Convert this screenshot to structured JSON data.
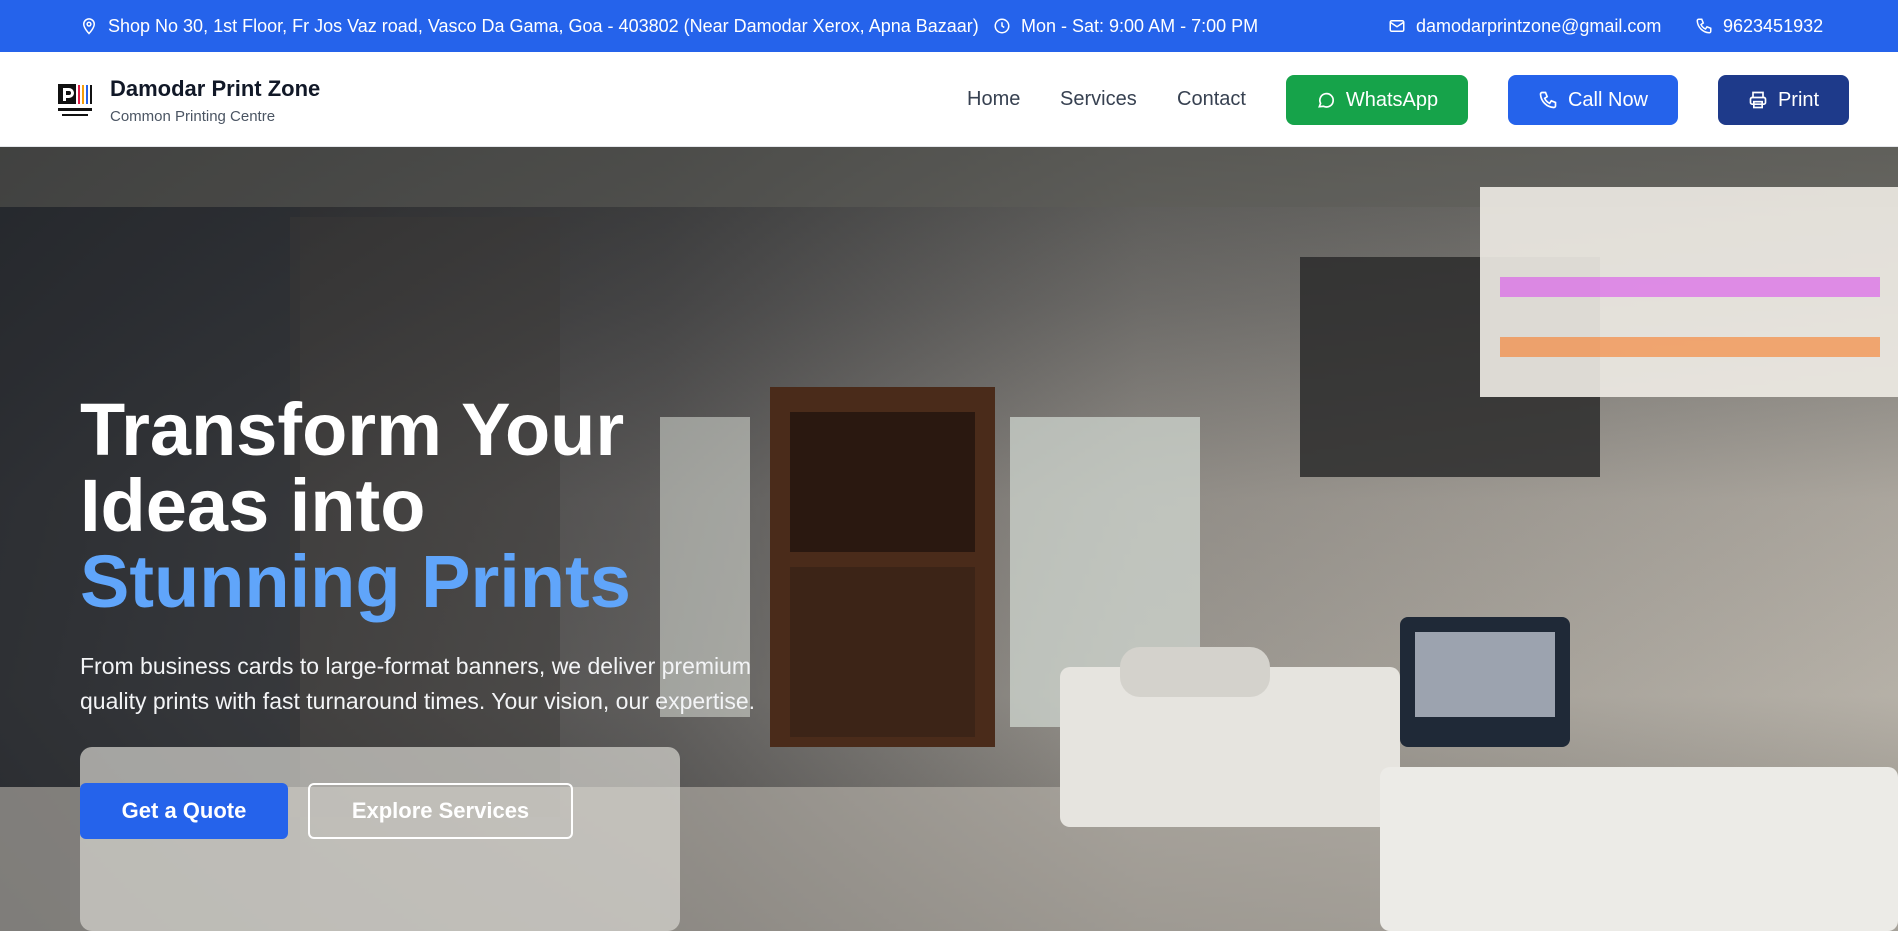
{
  "topbar": {
    "address": "Shop No 30, 1st Floor, Fr Jos Vaz road, Vasco Da Gama, Goa - 403802 (Near Damodar Xerox, Apna Bazaar)",
    "hours": "Mon - Sat: 9:00 AM - 7:00 PM",
    "email": "damodarprintzone@gmail.com",
    "phone": "9623451932",
    "icons": [
      "map-pin-icon",
      "clock-icon",
      "mail-icon",
      "phone-icon"
    ]
  },
  "header": {
    "logo_text": "DAMODAR PRINT ZONE",
    "brand_name": "Damodar Print Zone",
    "brand_tagline": "Common Printing Centre",
    "nav": [
      "Home",
      "Services",
      "Contact"
    ],
    "whatsapp_label": "WhatsApp",
    "call_label": "Call Now",
    "print_label": "Print"
  },
  "hero": {
    "title_line1": "Transform Your",
    "title_line2": "Ideas into",
    "title_accent": "Stunning Prints",
    "description": "From business cards to large-format banners, we deliver premium quality prints with fast turnaround times. Your vision, our expertise.",
    "primary_cta": "Get a Quote",
    "secondary_cta": "Explore Services"
  },
  "colors": {
    "brand_blue": "#2563eb",
    "whatsapp_green": "#16a34a",
    "print_navy": "#1e3a8a",
    "accent_light_blue": "#60a5fa"
  }
}
